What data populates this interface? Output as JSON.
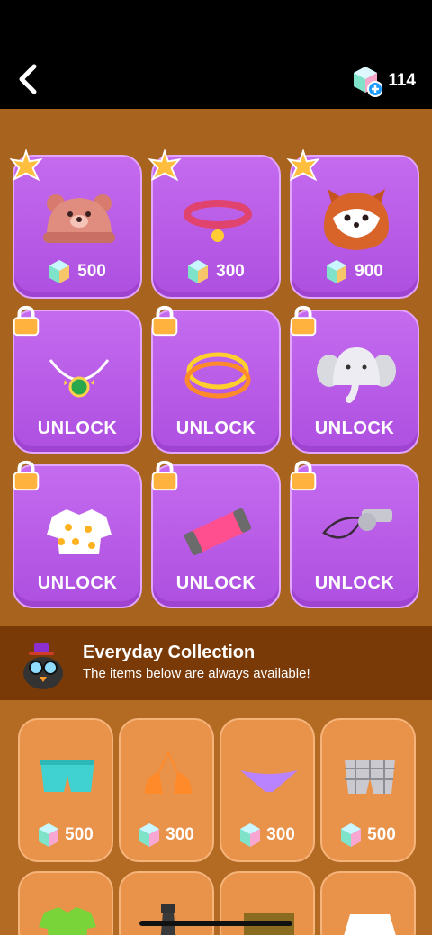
{
  "header": {
    "gem_count": "114"
  },
  "top_partial_row": [
    {
      "price": "900",
      "selected": true
    },
    {
      "price": "500",
      "selected": false
    },
    {
      "price": "300",
      "selected": false
    }
  ],
  "shop_items": [
    {
      "name": "bear hat",
      "price": "500",
      "locked": false,
      "icon": "bear-hat-icon"
    },
    {
      "name": "collar",
      "price": "300",
      "locked": false,
      "icon": "collar-icon"
    },
    {
      "name": "red panda hood",
      "price": "900",
      "locked": false,
      "icon": "red-panda-hood-icon"
    },
    {
      "name": "gem necklace",
      "action": "UNLOCK",
      "locked": true,
      "icon": "necklace-icon"
    },
    {
      "name": "gold rings",
      "action": "UNLOCK",
      "locked": true,
      "icon": "rings-icon"
    },
    {
      "name": "elephant hat",
      "action": "UNLOCK",
      "locked": true,
      "icon": "elephant-hat-icon"
    },
    {
      "name": "pineapple shirt",
      "action": "UNLOCK",
      "locked": true,
      "icon": "pineapple-shirt-icon"
    },
    {
      "name": "pink sweatband",
      "action": "UNLOCK",
      "locked": true,
      "icon": "sweatband-icon"
    },
    {
      "name": "whistle",
      "action": "UNLOCK",
      "locked": true,
      "icon": "whistle-icon"
    }
  ],
  "collection": {
    "title": "Everyday Collection",
    "subtitle": "The items below are always available!"
  },
  "everyday_items": [
    {
      "name": "teal shorts",
      "price": "500",
      "icon": "shorts-icon"
    },
    {
      "name": "orange bikini top",
      "price": "300",
      "icon": "bikini-top-icon"
    },
    {
      "name": "purple bikini bottom",
      "price": "300",
      "icon": "bikini-bottom-icon"
    },
    {
      "name": "plaid shorts",
      "price": "500",
      "icon": "plaid-shorts-icon"
    }
  ]
}
